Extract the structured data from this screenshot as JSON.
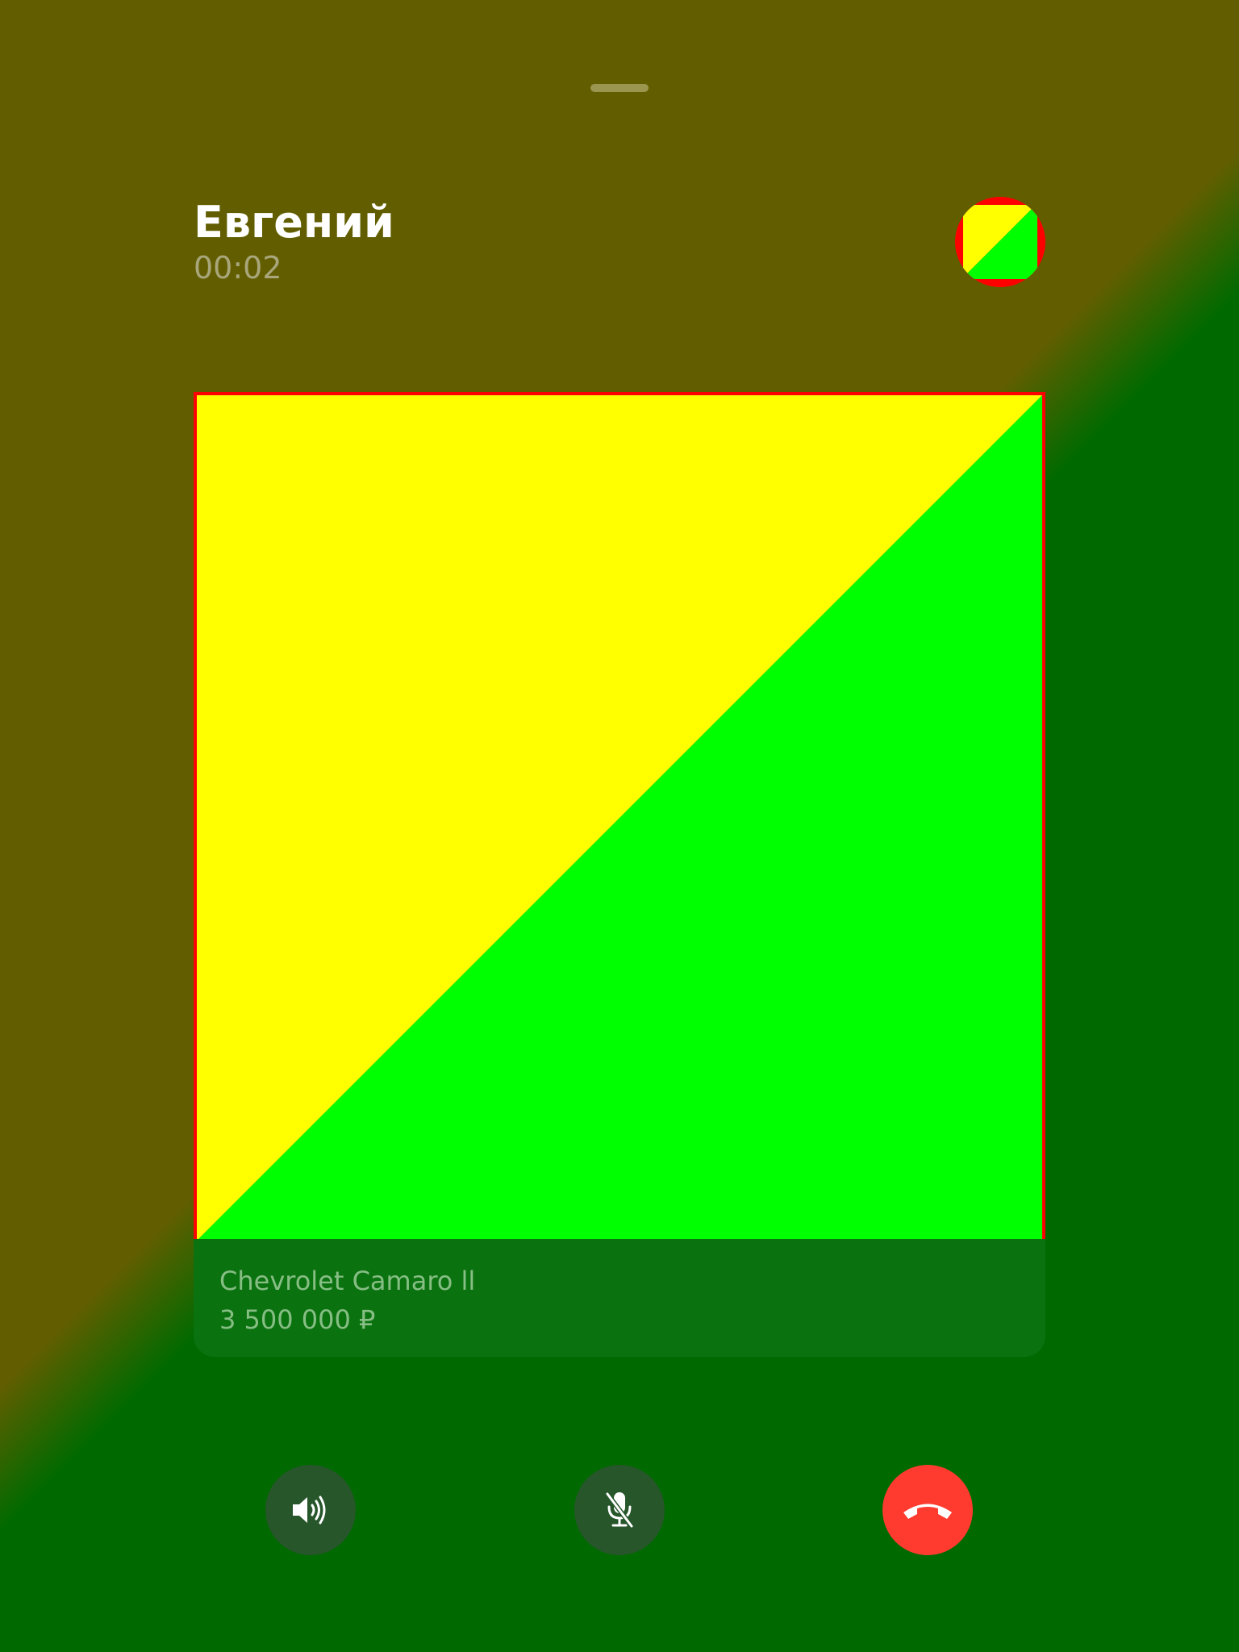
{
  "call": {
    "caller_name": "Евгений",
    "duration": "00:02"
  },
  "product": {
    "title": "Chevrolet Camaro ll",
    "price": "3 500 000 ₽"
  },
  "controls": {
    "speaker_icon": "speaker-icon",
    "mute_icon": "microphone-off-icon",
    "hangup_icon": "phone-hangup-icon"
  },
  "colors": {
    "background_top": "#625e00",
    "background_bottom": "#006a00",
    "image_yellow": "#ffff00",
    "image_green": "#00ff00",
    "image_border": "#ff0000",
    "hangup_red": "#ff3b30",
    "control_bg": "#26562a"
  }
}
